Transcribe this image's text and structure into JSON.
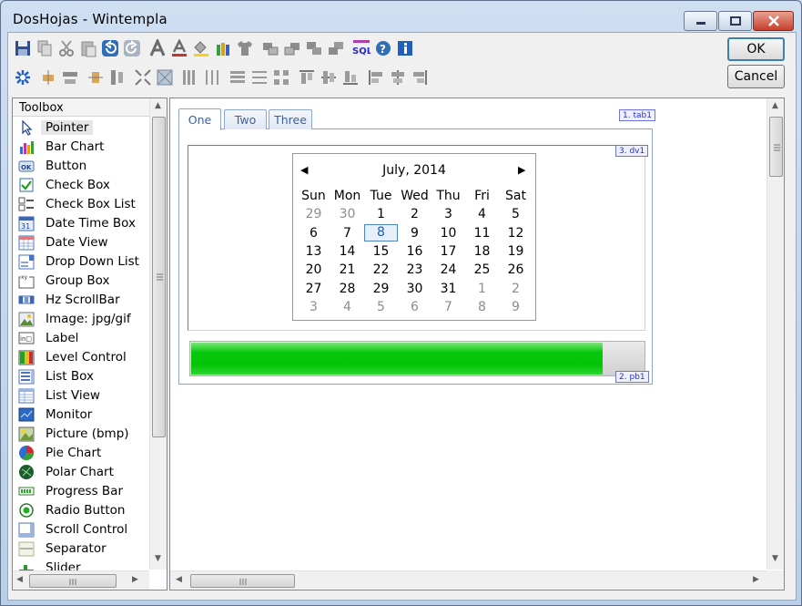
{
  "window": {
    "title": "DosHojas  -  Wintempla"
  },
  "dialog": {
    "ok_label": "OK",
    "cancel_label": "Cancel"
  },
  "toolbar": {
    "row1": [
      "save-icon",
      "copy-icon",
      "cut-icon",
      "paste-icon",
      "undo-icon",
      "redo-icon",
      "font-icon",
      "font-color-icon",
      "fill-color-icon",
      "pencils-icon",
      "shirt-icon",
      "bring-front-icon",
      "send-back-icon",
      "forward-icon",
      "backward-icon",
      "sql-icon",
      "help-icon",
      "info-icon"
    ],
    "row2": [
      "tab-order-icon",
      "center-horizontal-icon",
      "space-horizontal-icon",
      "center-vertical-icon",
      "space-vertical-icon",
      "shrink-icon",
      "expand-icon",
      "columns-icon",
      "columns-equal-icon",
      "rows-icon",
      "rows-equal-icon",
      "grid-icon",
      "align-top-icon",
      "align-middle-icon",
      "align-bottom-icon",
      "align-left-icon",
      "align-center-icon",
      "align-right-icon"
    ],
    "sql_label": "SQL"
  },
  "toolbox": {
    "header": "Toolbox",
    "selected_index": 0,
    "items": [
      {
        "label": "Pointer",
        "icon": "pointer-icon"
      },
      {
        "label": "Bar Chart",
        "icon": "bar-chart-icon"
      },
      {
        "label": "Button",
        "icon": "button-icon"
      },
      {
        "label": "Check Box",
        "icon": "check-box-icon"
      },
      {
        "label": "Check Box List",
        "icon": "check-box-list-icon"
      },
      {
        "label": "Date Time Box",
        "icon": "date-time-box-icon"
      },
      {
        "label": "Date View",
        "icon": "date-view-icon"
      },
      {
        "label": "Drop Down List",
        "icon": "drop-down-list-icon"
      },
      {
        "label": "Group Box",
        "icon": "group-box-icon"
      },
      {
        "label": "Hz ScrollBar",
        "icon": "hz-scrollbar-icon"
      },
      {
        "label": "Image: jpg/gif",
        "icon": "image-icon"
      },
      {
        "label": "Label",
        "icon": "label-icon"
      },
      {
        "label": "Level Control",
        "icon": "level-control-icon"
      },
      {
        "label": "List Box",
        "icon": "list-box-icon"
      },
      {
        "label": "List View",
        "icon": "list-view-icon"
      },
      {
        "label": "Monitor",
        "icon": "monitor-icon"
      },
      {
        "label": "Picture (bmp)",
        "icon": "picture-icon"
      },
      {
        "label": "Pie Chart",
        "icon": "pie-chart-icon"
      },
      {
        "label": "Polar Chart",
        "icon": "polar-chart-icon"
      },
      {
        "label": "Progress Bar",
        "icon": "progress-bar-icon"
      },
      {
        "label": "Radio Button",
        "icon": "radio-button-icon"
      },
      {
        "label": "Scroll Control",
        "icon": "scroll-control-icon"
      },
      {
        "label": "Separator",
        "icon": "separator-icon"
      },
      {
        "label": "Slider",
        "icon": "slider-icon"
      }
    ]
  },
  "design": {
    "tabs": [
      {
        "label": "One",
        "active": true
      },
      {
        "label": "Two",
        "active": false
      },
      {
        "label": "Three",
        "active": false
      }
    ],
    "tab_tag": "1. tab1",
    "dateview_tag": "3. dv1",
    "progress_tag": "2. pb1",
    "progress_value": 0.91,
    "calendar": {
      "title": "July, 2014",
      "prev": "◀",
      "next": "▶",
      "days_of_week": [
        "Sun",
        "Mon",
        "Tue",
        "Wed",
        "Thu",
        "Fri",
        "Sat"
      ],
      "weeks": [
        [
          "29",
          "30",
          "1",
          "2",
          "3",
          "4",
          "5"
        ],
        [
          "6",
          "7",
          "8",
          "9",
          "10",
          "11",
          "12"
        ],
        [
          "13",
          "14",
          "15",
          "16",
          "17",
          "18",
          "19"
        ],
        [
          "20",
          "21",
          "22",
          "23",
          "24",
          "25",
          "26"
        ],
        [
          "27",
          "28",
          "29",
          "30",
          "31",
          "1",
          "2"
        ],
        [
          "3",
          "4",
          "5",
          "6",
          "7",
          "8",
          "9"
        ]
      ],
      "other_month": [
        [
          0,
          0
        ],
        [
          0,
          1
        ],
        [
          4,
          5
        ],
        [
          4,
          6
        ],
        [
          5,
          0
        ],
        [
          5,
          1
        ],
        [
          5,
          2
        ],
        [
          5,
          3
        ],
        [
          5,
          4
        ],
        [
          5,
          5
        ],
        [
          5,
          6
        ]
      ],
      "today": [
        1,
        2
      ]
    }
  },
  "colors": {
    "accent": "#3c7fb1",
    "progress_green": "#04c408",
    "tag_blue": "#2a32c4"
  }
}
